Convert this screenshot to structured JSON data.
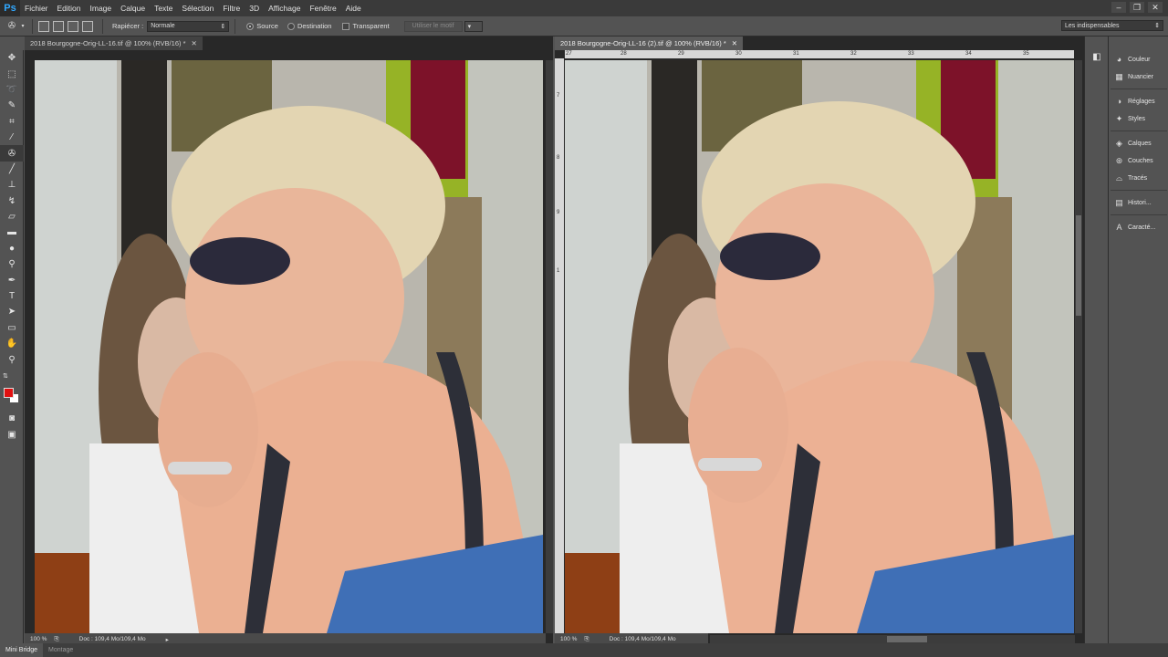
{
  "app": {
    "logo": "Ps"
  },
  "menu": [
    "Fichier",
    "Edition",
    "Image",
    "Calque",
    "Texte",
    "Sélection",
    "Filtre",
    "3D",
    "Affichage",
    "Fenêtre",
    "Aide"
  ],
  "window_controls": [
    "–",
    "❐",
    "✕"
  ],
  "options": {
    "rapiecer_label": "Rapiécer :",
    "mode_value": "Normale",
    "source_label": "Source",
    "destination_label": "Destination",
    "transparent_label": "Transparent",
    "use_pattern_label": "Utiliser le motif",
    "workspace_value": "Les indispensables"
  },
  "documents": [
    {
      "tab_title": "2018 Bourgogne-Orig-LL-16.tif @ 100% (RVB/16) *",
      "zoom": "100 %",
      "doc_info": "Doc : 109,4 Mo/109,4 Mo"
    },
    {
      "tab_title": "2018 Bourgogne-Orig-LL-16 (2).tif @ 100% (RVB/16) *",
      "zoom": "100 %",
      "doc_info": "Doc : 109,4 Mo/109,4 Mo",
      "ruler_numbers": [
        "27",
        "28",
        "29",
        "30",
        "31",
        "32",
        "33",
        "34",
        "35"
      ],
      "vruler_numbers": [
        "7",
        "8",
        "9",
        "1"
      ]
    }
  ],
  "panels": [
    {
      "label": "Couleur",
      "icon": "color-wheel-icon"
    },
    {
      "label": "Nuancier",
      "icon": "swatches-icon"
    },
    {
      "label": "Réglages",
      "icon": "adjustments-icon"
    },
    {
      "label": "Styles",
      "icon": "styles-icon"
    },
    {
      "label": "Calques",
      "icon": "layers-icon"
    },
    {
      "label": "Couches",
      "icon": "channels-icon"
    },
    {
      "label": "Tracés",
      "icon": "paths-icon"
    },
    {
      "label": "Histori...",
      "icon": "history-icon"
    },
    {
      "label": "Caracté...",
      "icon": "character-icon"
    }
  ],
  "bottom_tabs": [
    "Mini Bridge",
    "Montage"
  ],
  "colors": {
    "foreground": "#e01010",
    "background": "#ffffff",
    "accent": "#31a8ff"
  }
}
